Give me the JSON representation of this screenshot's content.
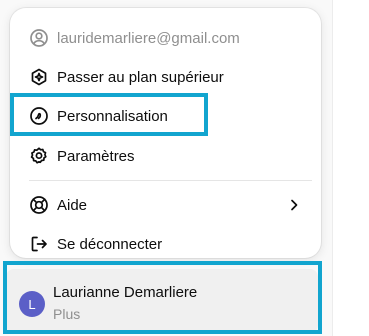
{
  "menu": {
    "email": "lauridemarliere@gmail.com",
    "items": [
      {
        "label": "Passer au plan supérieur",
        "icon": "upgrade-sparkle-icon"
      },
      {
        "label": "Personnalisation",
        "icon": "customize-icon"
      },
      {
        "label": "Paramètres",
        "icon": "gear-icon"
      },
      {
        "label": "Aide",
        "icon": "lifebuoy-icon"
      },
      {
        "label": "Se déconnecter",
        "icon": "logout-icon"
      }
    ]
  },
  "account": {
    "avatar_letter": "L",
    "name": "Laurianne Demarliere",
    "plan": "Plus"
  },
  "colors": {
    "highlight": "#12a5cf",
    "avatar": "#5b5fc7",
    "muted_text": "#8f8f8f"
  }
}
